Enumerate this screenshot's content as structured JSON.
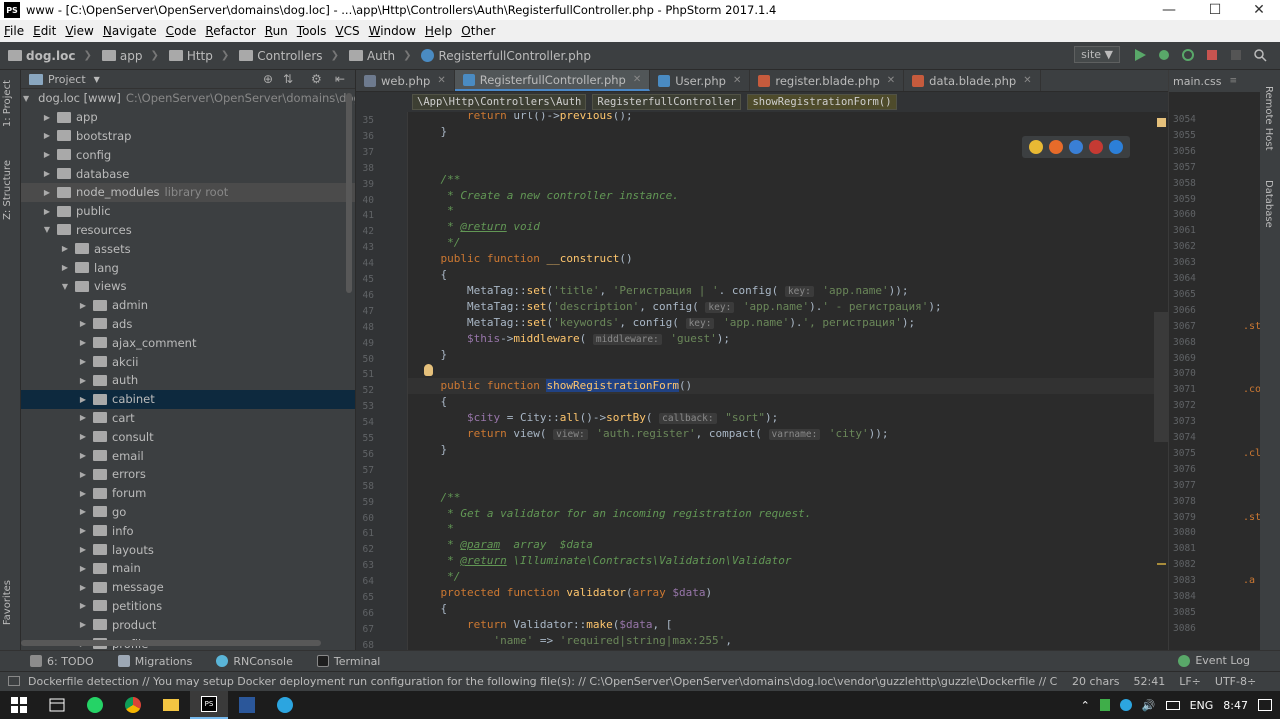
{
  "window": {
    "title": "www - [C:\\OpenServer\\OpenServer\\domains\\dog.loc] - ...\\app\\Http\\Controllers\\Auth\\RegisterfullController.php - PhpStorm 2017.1.4",
    "app_icon": "PS"
  },
  "menu": [
    "File",
    "Edit",
    "View",
    "Navigate",
    "Code",
    "Refactor",
    "Run",
    "Tools",
    "VCS",
    "Window",
    "Help",
    "Other"
  ],
  "breadcrumbs": [
    "dog.loc",
    "app",
    "Http",
    "Controllers",
    "Auth",
    "RegisterfullController.php"
  ],
  "run_config": "site",
  "left_tabs": [
    "1: Project",
    "Z: Structure",
    "Favorites"
  ],
  "right_tabs": [
    "Remote Host",
    "Database"
  ],
  "project_panel": {
    "title": "Project",
    "root": {
      "name": "dog.loc [www]",
      "path": "C:\\OpenServer\\OpenServer\\domains\\dog.loc"
    },
    "items": [
      {
        "name": "app",
        "depth": 1,
        "meta": ""
      },
      {
        "name": "bootstrap",
        "depth": 1,
        "meta": ""
      },
      {
        "name": "config",
        "depth": 1,
        "meta": ""
      },
      {
        "name": "database",
        "depth": 1,
        "meta": ""
      },
      {
        "name": "node_modules",
        "depth": 1,
        "meta": "library root"
      },
      {
        "name": "public",
        "depth": 1,
        "meta": ""
      },
      {
        "name": "resources",
        "depth": 1,
        "meta": "",
        "open": true
      },
      {
        "name": "assets",
        "depth": 2,
        "meta": ""
      },
      {
        "name": "lang",
        "depth": 2,
        "meta": ""
      },
      {
        "name": "views",
        "depth": 2,
        "meta": "",
        "open": true
      },
      {
        "name": "admin",
        "depth": 3,
        "meta": ""
      },
      {
        "name": "ads",
        "depth": 3,
        "meta": ""
      },
      {
        "name": "ajax_comment",
        "depth": 3,
        "meta": ""
      },
      {
        "name": "akcii",
        "depth": 3,
        "meta": ""
      },
      {
        "name": "auth",
        "depth": 3,
        "meta": ""
      },
      {
        "name": "cabinet",
        "depth": 3,
        "meta": "",
        "selected": true
      },
      {
        "name": "cart",
        "depth": 3,
        "meta": ""
      },
      {
        "name": "consult",
        "depth": 3,
        "meta": ""
      },
      {
        "name": "email",
        "depth": 3,
        "meta": ""
      },
      {
        "name": "errors",
        "depth": 3,
        "meta": ""
      },
      {
        "name": "forum",
        "depth": 3,
        "meta": ""
      },
      {
        "name": "go",
        "depth": 3,
        "meta": ""
      },
      {
        "name": "info",
        "depth": 3,
        "meta": ""
      },
      {
        "name": "layouts",
        "depth": 3,
        "meta": ""
      },
      {
        "name": "main",
        "depth": 3,
        "meta": ""
      },
      {
        "name": "message",
        "depth": 3,
        "meta": ""
      },
      {
        "name": "petitions",
        "depth": 3,
        "meta": ""
      },
      {
        "name": "product",
        "depth": 3,
        "meta": ""
      },
      {
        "name": "profile",
        "depth": 3,
        "meta": ""
      }
    ]
  },
  "tabs": [
    {
      "label": "web.php",
      "color": "#6e7b8f",
      "active": false
    },
    {
      "label": "RegisterfullController.php",
      "color": "#4a8bc2",
      "active": true
    },
    {
      "label": "User.php",
      "color": "#4a8bc2",
      "active": false
    },
    {
      "label": "register.blade.php",
      "color": "#c65b3d",
      "active": false
    },
    {
      "label": "data.blade.php",
      "color": "#c65b3d",
      "active": false
    }
  ],
  "side_tab": "main.css",
  "path_chips": [
    "\\App\\Http\\Controllers\\Auth",
    "RegisterfullController",
    "showRegistrationForm()"
  ],
  "code": {
    "first_line": 35,
    "lines": [
      "        return url()->previous();",
      "    }",
      "",
      "",
      "    /**",
      "     * Create a new controller instance.",
      "     *",
      "     * @return void",
      "     */",
      "    public function __construct()",
      "    {",
      "        MetaTag::set('title', 'Регистрация | '. config( key: 'app.name'));",
      "        MetaTag::set('description', config( key: 'app.name').' - регистрация');",
      "        MetaTag::set('keywords', config( key: 'app.name').', регистрация');",
      "        $this->middleware( middleware: 'guest');",
      "    }",
      "",
      "    public function showRegistrationForm()",
      "    {",
      "        $city = City::all()->sortBy( callback: \"sort\");",
      "        return view( view: 'auth.register', compact( varname: 'city'));",
      "    }",
      "",
      "",
      "    /**",
      "     * Get a validator for an incoming registration request.",
      "     *",
      "     * @param  array  $data",
      "     * @return \\Illuminate\\Contracts\\Validation\\Validator",
      "     */",
      "    protected function validator(array $data)",
      "    {",
      "        return Validator::make($data, [",
      "            'name' => 'required|string|max:255',"
    ]
  },
  "css_pane": {
    "line_start": 3054,
    "line_count": 33,
    "snippets": [
      ".st",
      ".co",
      ".cl",
      ".st",
      ".a"
    ]
  },
  "tool_windows": [
    "6: TODO",
    "Migrations",
    "RNConsole",
    "Terminal"
  ],
  "event_log": "Event Log",
  "status": {
    "message": "Dockerfile detection  // You may setup Docker deployment run configuration for the following file(s): // C:\\OpenServer\\OpenServer\\domains\\dog.loc\\vendor\\guzzlehttp\\guzzle\\Dockerfile // C:\\OpenServer\\...",
    "chars": "20 chars",
    "position": "52:41",
    "line_sep": "LF÷",
    "encoding": "UTF-8÷"
  },
  "taskbar": {
    "lang": "ENG",
    "time": "8:47"
  },
  "colors": {
    "editor_bg": "#2b2b2b",
    "panel_bg": "#3c3f41",
    "keyword": "#cc7832",
    "string": "#6a8759",
    "selection": "#0d293e"
  }
}
